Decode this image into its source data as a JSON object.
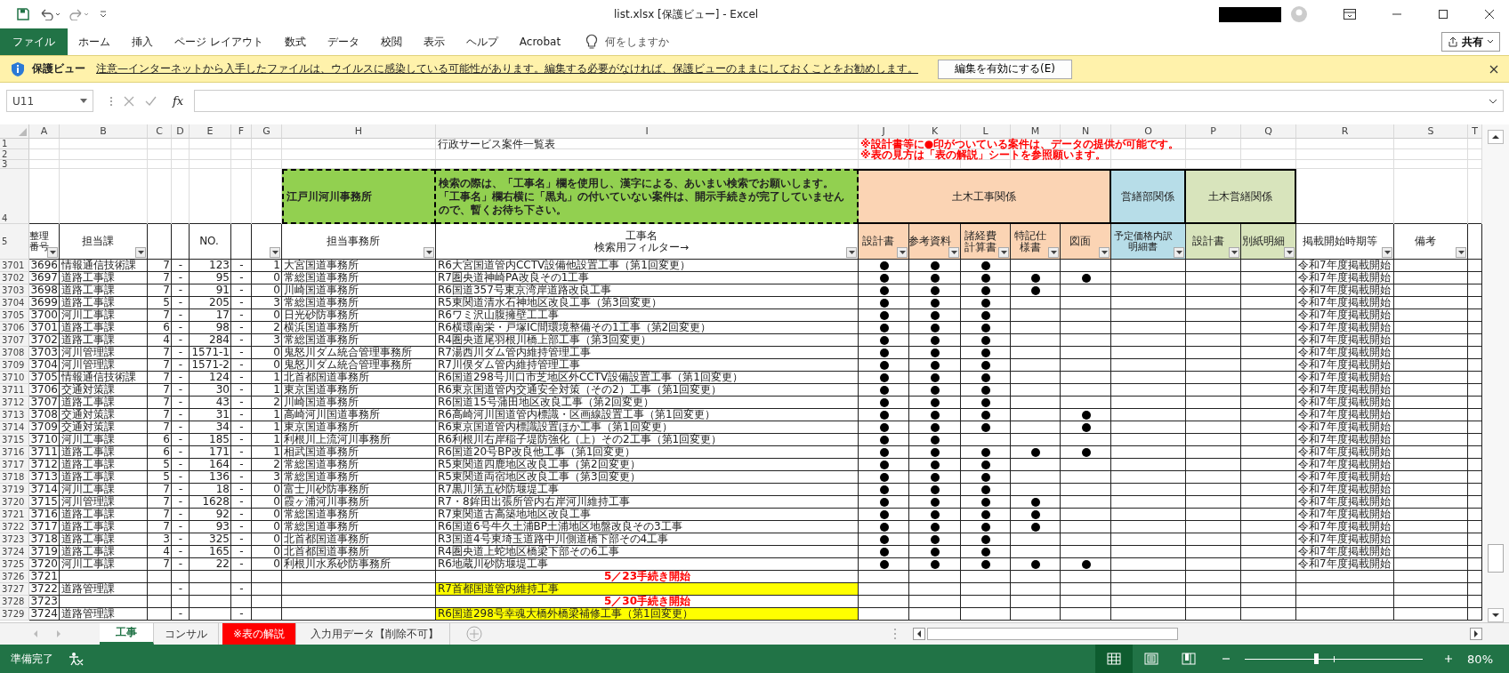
{
  "window": {
    "title": "list.xlsx [保護ビュー] - Excel"
  },
  "ribbon": {
    "tabs": [
      {
        "label": "ファイル",
        "kind": "file"
      },
      {
        "label": "ホーム",
        "kind": "tab"
      },
      {
        "label": "挿入",
        "kind": "tab"
      },
      {
        "label": "ページ レイアウト",
        "kind": "tab"
      },
      {
        "label": "数式",
        "kind": "tab"
      },
      {
        "label": "データ",
        "kind": "tab"
      },
      {
        "label": "校閲",
        "kind": "tab"
      },
      {
        "label": "表示",
        "kind": "tab"
      },
      {
        "label": "ヘルプ",
        "kind": "tab"
      },
      {
        "label": "Acrobat",
        "kind": "tab"
      }
    ],
    "tell_me": "何をしますか",
    "share": "共有"
  },
  "protected_view": {
    "title": "保護ビュー",
    "message": "注意—インターネットから入手したファイルは、ウイルスに感染している可能性があります。編集する必要がなければ、保護ビューのままにしておくことをお勧めします。",
    "button": "編集を有効にする(E)"
  },
  "formula_bar": {
    "name_box": "U11",
    "function_label": "fx"
  },
  "sheet": {
    "column_letters": [
      "A",
      "B",
      "C",
      "D",
      "E",
      "F",
      "G",
      "H",
      "I",
      "J",
      "K",
      "L",
      "M",
      "N",
      "O",
      "P",
      "Q",
      "R",
      "S",
      "T"
    ],
    "title_row": {
      "row": "1",
      "title": "行政サービス案件一覧表",
      "note": "※設計書等に●印がついている案件は、データの提供が可能です。"
    },
    "note_row": {
      "row": "2",
      "note": "※表の見方は「表の解説」シートを参照願います。"
    },
    "blank_row": {
      "row": "3"
    },
    "group_row": {
      "row": "4",
      "office": "江戸川河川事務所",
      "instructions": "検索の際は、「工事名」欄を使用し、漢字による、あいまい検索でお願いします。「工事名」欄右横に「黒丸」の付いていない案件は、開示手続きが完了していませんので、暫くお待ち下さい。",
      "groups": [
        "土木工事関係",
        "営繕部関係",
        "土木営繕関係"
      ]
    },
    "header_row": {
      "row": "5",
      "headers": [
        {
          "label": "整理番号"
        },
        {
          "label": "担当課"
        },
        {
          "label": "NO."
        },
        {
          "label": "担当事務所"
        },
        {
          "label": "工事名",
          "sub": "検索用フィルター→"
        },
        {
          "label": "設計書"
        },
        {
          "label": "参考資料"
        },
        {
          "label": "諸経費計算書"
        },
        {
          "label": "特記仕様書"
        },
        {
          "label": "図面"
        },
        {
          "label": "予定価格内訳明細書"
        },
        {
          "label": "設計書"
        },
        {
          "label": "別紙明細"
        },
        {
          "label": "掲載開始時期等"
        },
        {
          "label": "備考"
        }
      ]
    },
    "rows": [
      {
        "kind": "data",
        "row": "3701",
        "a": "3696",
        "b": "情報通信技術課",
        "c": "7",
        "d": "-",
        "e": "123",
        "f": "-",
        "g": "1",
        "h": "大宮国道事務所",
        "i": "R6大宮国道管内CCTV設備他設置工事（第1回変更）",
        "marks": [
          true,
          true,
          true,
          false,
          false
        ],
        "r": "令和7年度掲載開始"
      },
      {
        "kind": "data",
        "row": "3702",
        "a": "3697",
        "b": "道路工事課",
        "c": "7",
        "d": "-",
        "e": "95",
        "f": "-",
        "g": "0",
        "h": "常総国道事務所",
        "i": "R7圏央道神崎PA改良その1工事",
        "marks": [
          true,
          true,
          true,
          true,
          true
        ],
        "r": "令和7年度掲載開始"
      },
      {
        "kind": "data",
        "row": "3703",
        "a": "3698",
        "b": "道路工事課",
        "c": "7",
        "d": "-",
        "e": "91",
        "f": "-",
        "g": "0",
        "h": "川崎国道事務所",
        "i": "R6国道357号東京湾岸道路改良工事",
        "marks": [
          true,
          true,
          true,
          true,
          false
        ],
        "r": "令和7年度掲載開始"
      },
      {
        "kind": "data",
        "row": "3704",
        "a": "3699",
        "b": "道路工事課",
        "c": "5",
        "d": "-",
        "e": "205",
        "f": "-",
        "g": "3",
        "h": "常総国道事務所",
        "i": "R5東関道清水石神地区改良工事（第3回変更）",
        "marks": [
          true,
          true,
          true,
          false,
          false
        ],
        "r": "令和7年度掲載開始"
      },
      {
        "kind": "data",
        "row": "3705",
        "a": "3700",
        "b": "河川工事課",
        "c": "7",
        "d": "-",
        "e": "17",
        "f": "-",
        "g": "0",
        "h": "日光砂防事務所",
        "i": "R6ワミ沢山腹擁壁工工事",
        "marks": [
          true,
          true,
          true,
          false,
          false
        ],
        "r": "令和7年度掲載開始"
      },
      {
        "kind": "data",
        "row": "3706",
        "a": "3701",
        "b": "道路工事課",
        "c": "6",
        "d": "-",
        "e": "98",
        "f": "-",
        "g": "2",
        "h": "横浜国道事務所",
        "i": "R6横環南栄・戸塚IC間環境整備その1工事（第2回変更）",
        "marks": [
          true,
          true,
          true,
          false,
          false
        ],
        "r": "令和7年度掲載開始"
      },
      {
        "kind": "data",
        "row": "3707",
        "a": "3702",
        "b": "道路工事課",
        "c": "4",
        "d": "-",
        "e": "284",
        "f": "-",
        "g": "3",
        "h": "常総国道事務所",
        "i": "R4圏央道尾羽根川橋上部工事（第3回変更）",
        "marks": [
          true,
          true,
          true,
          false,
          false
        ],
        "r": "令和7年度掲載開始"
      },
      {
        "kind": "data",
        "row": "3708",
        "a": "3703",
        "b": "河川管理課",
        "c": "7",
        "d": "-",
        "e": "1571-1",
        "f": "-",
        "g": "0",
        "h": "鬼怒川ダム統合管理事務所",
        "i": "R7湯西川ダム管内維持管理工事",
        "marks": [
          true,
          true,
          true,
          false,
          false
        ],
        "r": "令和7年度掲載開始"
      },
      {
        "kind": "data",
        "row": "3709",
        "a": "3704",
        "b": "河川管理課",
        "c": "7",
        "d": "-",
        "e": "1571-2",
        "f": "-",
        "g": "0",
        "h": "鬼怒川ダム統合管理事務所",
        "i": "R7川俣ダム管内維持管理工事",
        "marks": [
          true,
          true,
          true,
          false,
          false
        ],
        "r": "令和7年度掲載開始"
      },
      {
        "kind": "data",
        "row": "3710",
        "a": "3705",
        "b": "情報通信技術課",
        "c": "7",
        "d": "-",
        "e": "124",
        "f": "-",
        "g": "1",
        "h": "北首都国道事務所",
        "i": "R6国道298号川口市芝地区外CCTV設備設置工事（第1回変更）",
        "marks": [
          true,
          true,
          true,
          false,
          false
        ],
        "r": "令和7年度掲載開始"
      },
      {
        "kind": "data",
        "row": "3711",
        "a": "3706",
        "b": "交通対策課",
        "c": "7",
        "d": "-",
        "e": "30",
        "f": "-",
        "g": "1",
        "h": "東京国道事務所",
        "i": "R6東京国道管内交通安全対策（その2）工事（第1回変更）",
        "marks": [
          true,
          true,
          true,
          false,
          false
        ],
        "r": "令和7年度掲載開始"
      },
      {
        "kind": "data",
        "row": "3712",
        "a": "3707",
        "b": "道路工事課",
        "c": "7",
        "d": "-",
        "e": "43",
        "f": "-",
        "g": "2",
        "h": "川崎国道事務所",
        "i": "R6国道15号蒲田地区改良工事（第2回変更）",
        "marks": [
          true,
          true,
          true,
          false,
          false
        ],
        "r": "令和7年度掲載開始"
      },
      {
        "kind": "data",
        "row": "3713",
        "a": "3708",
        "b": "交通対策課",
        "c": "7",
        "d": "-",
        "e": "31",
        "f": "-",
        "g": "1",
        "h": "高崎河川国道事務所",
        "i": "R6高崎河川国道管内標識・区画線設置工事（第1回変更）",
        "marks": [
          true,
          true,
          true,
          false,
          true
        ],
        "r": "令和7年度掲載開始"
      },
      {
        "kind": "data",
        "row": "3714",
        "a": "3709",
        "b": "交通対策課",
        "c": "7",
        "d": "-",
        "e": "34",
        "f": "-",
        "g": "1",
        "h": "東京国道事務所",
        "i": "R6東京国道管内標識設置ほか工事（第1回変更）",
        "marks": [
          true,
          true,
          true,
          false,
          true
        ],
        "r": "令和7年度掲載開始"
      },
      {
        "kind": "data",
        "row": "3715",
        "a": "3710",
        "b": "河川工事課",
        "c": "6",
        "d": "-",
        "e": "185",
        "f": "-",
        "g": "1",
        "h": "利根川上流河川事務所",
        "i": "R6利根川右岸稲子堤防強化（上）その2工事（第1回変更）",
        "marks": [
          true,
          true,
          false,
          false,
          false
        ],
        "r": "令和7年度掲載開始"
      },
      {
        "kind": "data",
        "row": "3716",
        "a": "3711",
        "b": "道路工事課",
        "c": "6",
        "d": "-",
        "e": "171",
        "f": "-",
        "g": "1",
        "h": "相武国道事務所",
        "i": "R6国道20号BP改良他工事（第1回変更）",
        "marks": [
          true,
          true,
          true,
          true,
          true
        ],
        "r": "令和7年度掲載開始"
      },
      {
        "kind": "data",
        "row": "3717",
        "a": "3712",
        "b": "道路工事課",
        "c": "5",
        "d": "-",
        "e": "164",
        "f": "-",
        "g": "2",
        "h": "常総国道事務所",
        "i": "R5東関道四鹿地区改良工事（第2回変更）",
        "marks": [
          true,
          true,
          true,
          false,
          false
        ],
        "r": "令和7年度掲載開始"
      },
      {
        "kind": "data",
        "row": "3718",
        "a": "3713",
        "b": "道路工事課",
        "c": "5",
        "d": "-",
        "e": "136",
        "f": "-",
        "g": "3",
        "h": "常総国道事務所",
        "i": "R5東関道両宿地区改良工事（第3回変更）",
        "marks": [
          true,
          true,
          true,
          false,
          false
        ],
        "r": "令和7年度掲載開始"
      },
      {
        "kind": "data",
        "row": "3719",
        "a": "3714",
        "b": "河川工事課",
        "c": "7",
        "d": "-",
        "e": "18",
        "f": "-",
        "g": "0",
        "h": "富士川砂防事務所",
        "i": "R7黒川第五砂防堰堤工事",
        "marks": [
          true,
          true,
          true,
          false,
          false
        ],
        "r": "令和7年度掲載開始"
      },
      {
        "kind": "data",
        "row": "3720",
        "a": "3715",
        "b": "河川管理課",
        "c": "7",
        "d": "-",
        "e": "1628",
        "f": "-",
        "g": "0",
        "h": "霞ヶ浦河川事務所",
        "i": "R7・8鉾田出張所管内右岸河川維持工事",
        "marks": [
          true,
          true,
          true,
          true,
          false
        ],
        "r": "令和7年度掲載開始"
      },
      {
        "kind": "data",
        "row": "3721",
        "a": "3716",
        "b": "道路工事課",
        "c": "7",
        "d": "-",
        "e": "92",
        "f": "-",
        "g": "0",
        "h": "常総国道事務所",
        "i": "R7東関道古高築地地区改良工事",
        "marks": [
          true,
          true,
          true,
          true,
          false
        ],
        "r": "令和7年度掲載開始"
      },
      {
        "kind": "data",
        "row": "3722",
        "a": "3717",
        "b": "道路工事課",
        "c": "7",
        "d": "-",
        "e": "93",
        "f": "-",
        "g": "0",
        "h": "常総国道事務所",
        "i": "R6国道6号牛久土浦BP土浦地区地盤改良その3工事",
        "marks": [
          true,
          true,
          true,
          true,
          false
        ],
        "r": "令和7年度掲載開始"
      },
      {
        "kind": "data",
        "row": "3723",
        "a": "3718",
        "b": "道路工事課",
        "c": "3",
        "d": "-",
        "e": "325",
        "f": "-",
        "g": "0",
        "h": "北首都国道事務所",
        "i": "R3国道4号東埼玉道路中川側道橋下部その4工事",
        "marks": [
          true,
          true,
          true,
          false,
          false
        ],
        "r": "令和7年度掲載開始"
      },
      {
        "kind": "data",
        "row": "3724",
        "a": "3719",
        "b": "道路工事課",
        "c": "4",
        "d": "-",
        "e": "165",
        "f": "-",
        "g": "0",
        "h": "北首都国道事務所",
        "i": "R4圏央道上蛇地区橋梁下部その6工事",
        "marks": [
          true,
          true,
          true,
          false,
          false
        ],
        "r": "令和7年度掲載開始"
      },
      {
        "kind": "data",
        "row": "3725",
        "a": "3720",
        "b": "河川工事課",
        "c": "7",
        "d": "-",
        "e": "22",
        "f": "-",
        "g": "0",
        "h": "利根川水系砂防事務所",
        "i": "R6地蔵川砂防堰堤工事",
        "marks": [
          true,
          true,
          true,
          true,
          true
        ],
        "r": "令和7年度掲載開始"
      },
      {
        "kind": "banner",
        "row": "3726",
        "a": "3721",
        "i": "5／23手続き開始"
      },
      {
        "kind": "pending",
        "row": "3727",
        "a": "3722",
        "b": "道路管理課",
        "d": "-",
        "f": "-",
        "i": "R7首都国道管内維持工事"
      },
      {
        "kind": "banner",
        "row": "3728",
        "a": "3723",
        "i": "5／30手続き開始"
      },
      {
        "kind": "pending",
        "row": "3729",
        "a": "3724",
        "b": "道路管理課",
        "d": "-",
        "f": "-",
        "i": "R6国道298号幸魂大橋外橋梁補修工事（第1回変更）"
      }
    ]
  },
  "sheet_tabs": [
    {
      "label": "工事",
      "selected": true
    },
    {
      "label": "コンサル",
      "selected": false
    },
    {
      "label": "※表の解説",
      "selected": false,
      "color": "#ff0000"
    },
    {
      "label": "入力用データ【削除不可】",
      "selected": false
    }
  ],
  "status_bar": {
    "status": "準備完了",
    "view_buttons": [
      {
        "kind": "normal",
        "selected": true
      },
      {
        "kind": "page_layout",
        "selected": false
      },
      {
        "kind": "page_break",
        "selected": false
      }
    ],
    "zoom": {
      "level": 0.4,
      "label": "80%"
    }
  }
}
